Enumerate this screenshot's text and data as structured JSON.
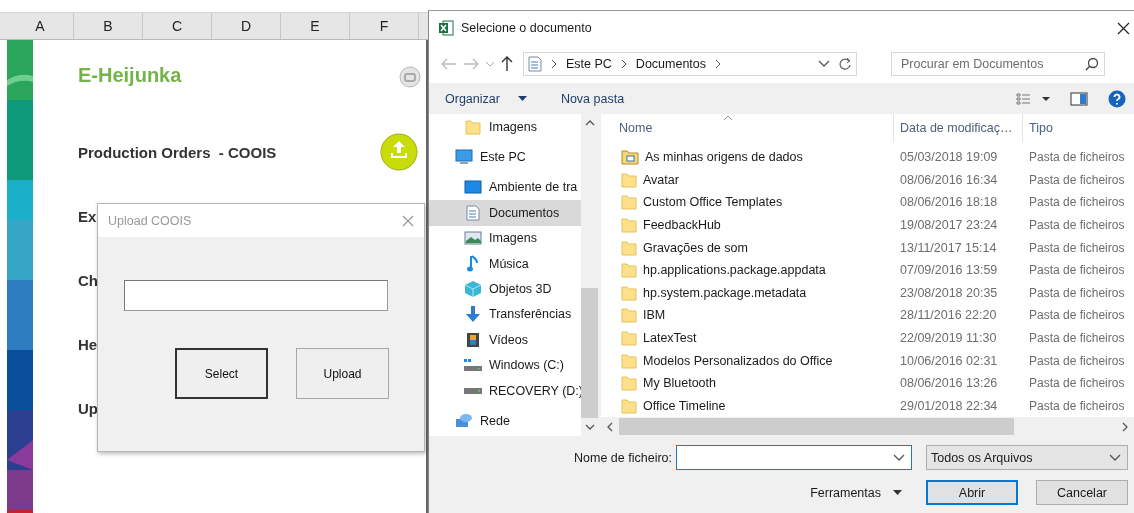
{
  "spreadsheet": {
    "columns": [
      "A",
      "B",
      "C",
      "D",
      "E",
      "F"
    ],
    "title": "E-Heijunka",
    "rows": [
      {
        "label": "Production Orders  - COOIS",
        "kind": "upload"
      },
      {
        "label": "Ex",
        "kind": "plain"
      },
      {
        "label": "Ch",
        "kind": "plain"
      },
      {
        "label": "He",
        "kind": "plain"
      },
      {
        "label": "Up",
        "kind": "plain"
      }
    ]
  },
  "upload_form": {
    "title": "Upload COOIS",
    "buttons": [
      {
        "label": "Select",
        "default": true
      },
      {
        "label": "Upload",
        "default": false
      }
    ]
  },
  "file_dialog": {
    "title": "Selecione o documento",
    "breadcrumb": [
      "Este PC",
      "Documentos"
    ],
    "search": {
      "placeholder": "Procurar em Documentos"
    },
    "toolbar": [
      {
        "label": "Organizar",
        "kind": "menu"
      },
      {
        "label": "Nova pasta",
        "kind": "plain"
      }
    ],
    "nav": [
      {
        "children": [
          {
            "label": "Imagens",
            "kind": "folder",
            "selected": false
          }
        ]
      },
      {
        "label": "Este PC",
        "kind": "pc",
        "selected": false,
        "children": [
          {
            "label": "Ambiente de tra",
            "kind": "desktop",
            "selected": false
          },
          {
            "label": "Documentos",
            "kind": "documents",
            "selected": true
          },
          {
            "label": "Imagens",
            "kind": "pictures",
            "selected": false
          },
          {
            "label": "Música",
            "kind": "music",
            "selected": false
          },
          {
            "label": "Objetos 3D",
            "kind": "objects",
            "selected": false
          },
          {
            "label": "Transferências",
            "kind": "downloads",
            "selected": false
          },
          {
            "label": "Vídeos",
            "kind": "videos",
            "selected": false
          },
          {
            "label": "Windows (C:)",
            "kind": "windrive",
            "selected": false
          },
          {
            "label": "RECOVERY (D:)",
            "kind": "drive",
            "selected": false
          }
        ]
      },
      {
        "label": "Rede",
        "kind": "network",
        "selected": false
      }
    ],
    "columns": [
      "Nome",
      "Data de modificaç…",
      "Tipo"
    ],
    "files": [
      {
        "name": "As minhas origens de dados",
        "modified": "05/03/2018 19:09",
        "type": "Pasta de ficheiros",
        "kind": "special"
      },
      {
        "name": "Avatar",
        "modified": "08/06/2016 16:34",
        "type": "Pasta de ficheiros",
        "kind": "folder"
      },
      {
        "name": "Custom Office Templates",
        "modified": "08/06/2016 18:18",
        "type": "Pasta de ficheiros",
        "kind": "folder"
      },
      {
        "name": "FeedbackHub",
        "modified": "19/08/2017 23:24",
        "type": "Pasta de ficheiros",
        "kind": "folder"
      },
      {
        "name": "Gravações de som",
        "modified": "13/11/2017 15:14",
        "type": "Pasta de ficheiros",
        "kind": "folder"
      },
      {
        "name": "hp.applications.package.appdata",
        "modified": "07/09/2016 13:59",
        "type": "Pasta de ficheiros",
        "kind": "folder"
      },
      {
        "name": "hp.system.package.metadata",
        "modified": "23/08/2018 20:35",
        "type": "Pasta de ficheiros",
        "kind": "folder"
      },
      {
        "name": "IBM",
        "modified": "28/11/2016 22:20",
        "type": "Pasta de ficheiros",
        "kind": "folder"
      },
      {
        "name": "LatexTest",
        "modified": "22/09/2019 11:30",
        "type": "Pasta de ficheiros",
        "kind": "folder"
      },
      {
        "name": "Modelos Personalizados do Office",
        "modified": "10/06/2016 02:31",
        "type": "Pasta de ficheiros",
        "kind": "folder"
      },
      {
        "name": "My Bluetooth",
        "modified": "08/06/2016 13:26",
        "type": "Pasta de ficheiros",
        "kind": "folder"
      },
      {
        "name": "Office Timeline",
        "modified": "29/01/2018 22:34",
        "type": "Pasta de ficheiros",
        "kind": "folder"
      }
    ],
    "filename": {
      "label": "Nome de ficheiro:"
    },
    "filter": "Todos os Arquivos",
    "tools": "Ferramentas",
    "buttons": [
      {
        "label": "Abrir",
        "default": true
      },
      {
        "label": "Cancelar",
        "default": false
      }
    ]
  }
}
